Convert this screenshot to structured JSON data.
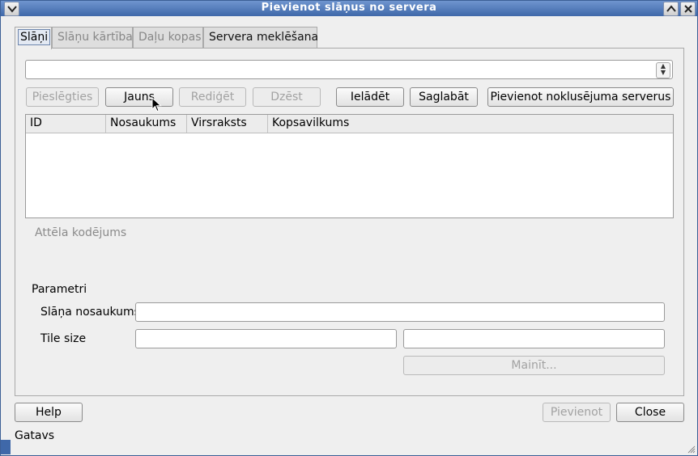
{
  "window": {
    "title": "Pievienot slāņus no servera"
  },
  "tabs": [
    {
      "label": "Slāņi",
      "active": true
    },
    {
      "label": "Slāņu kārtība",
      "active": false
    },
    {
      "label": "Daļu kopas",
      "active": false
    },
    {
      "label": "Servera meklēšana",
      "active": false
    }
  ],
  "server_select": {
    "value": ""
  },
  "buttons": {
    "connect": "Pieslēgties",
    "new": "Jauns",
    "edit": "Rediģēt",
    "delete": "Dzēst",
    "load": "Ielādēt",
    "save": "Saglabāt",
    "add_default": "Pievienot noklusējuma serverus"
  },
  "table": {
    "columns": [
      "ID",
      "Nosaukums",
      "Virsraksts",
      "Kopsavilkums"
    ],
    "rows": []
  },
  "image_encoding_label": "Attēla kodējums",
  "params": {
    "title": "Parametri",
    "layer_name_label": "Slāņa nosaukums",
    "layer_name_value": "",
    "tile_size_label": "Tile size",
    "tile_width": "",
    "tile_height": "",
    "change_button": "Mainīt..."
  },
  "footer": {
    "help": "Help",
    "add": "Pievienot",
    "close": "Close"
  },
  "status": "Gatavs"
}
